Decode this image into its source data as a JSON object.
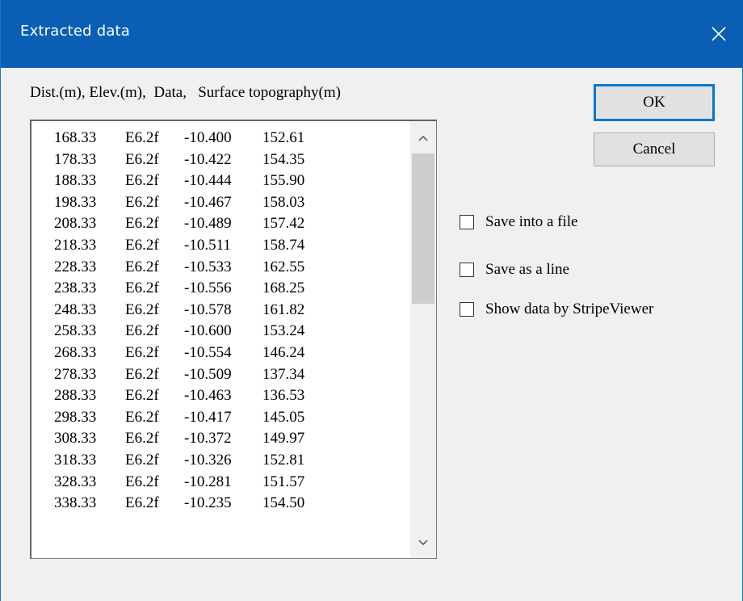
{
  "window": {
    "title": "Extracted data"
  },
  "header": "Dist.(m), Elev.(m),  Data,   Surface topography(m)",
  "rows": [
    [
      "168.33",
      "E6.2f",
      "-10.400",
      "152.61"
    ],
    [
      "178.33",
      "E6.2f",
      "-10.422",
      "154.35"
    ],
    [
      "188.33",
      "E6.2f",
      "-10.444",
      "155.90"
    ],
    [
      "198.33",
      "E6.2f",
      "-10.467",
      "158.03"
    ],
    [
      "208.33",
      "E6.2f",
      "-10.489",
      "157.42"
    ],
    [
      "218.33",
      "E6.2f",
      "-10.511",
      "158.74"
    ],
    [
      "228.33",
      "E6.2f",
      "-10.533",
      "162.55"
    ],
    [
      "238.33",
      "E6.2f",
      "-10.556",
      "168.25"
    ],
    [
      "248.33",
      "E6.2f",
      "-10.578",
      "161.82"
    ],
    [
      "258.33",
      "E6.2f",
      "-10.600",
      "153.24"
    ],
    [
      "268.33",
      "E6.2f",
      "-10.554",
      "146.24"
    ],
    [
      "278.33",
      "E6.2f",
      "-10.509",
      "137.34"
    ],
    [
      "288.33",
      "E6.2f",
      "-10.463",
      "136.53"
    ],
    [
      "298.33",
      "E6.2f",
      "-10.417",
      "145.05"
    ],
    [
      "308.33",
      "E6.2f",
      "-10.372",
      "149.97"
    ],
    [
      "318.33",
      "E6.2f",
      "-10.326",
      "152.81"
    ],
    [
      "328.33",
      "E6.2f",
      "-10.281",
      "151.57"
    ],
    [
      "338.33",
      "E6.2f",
      "-10.235",
      "154.50"
    ]
  ],
  "buttons": {
    "ok": "OK",
    "cancel": "Cancel"
  },
  "checkboxes": [
    {
      "label": "Save into a file",
      "checked": false
    },
    {
      "label": "Save as a line",
      "checked": false
    },
    {
      "label": "Show data by StripeViewer",
      "checked": false
    }
  ],
  "icons": {
    "close": "close-icon",
    "scroll_up": "chevron-up-icon",
    "scroll_down": "chevron-down-icon"
  },
  "colors": {
    "titlebar": "#0a5fb4",
    "accent": "#0078d7"
  }
}
